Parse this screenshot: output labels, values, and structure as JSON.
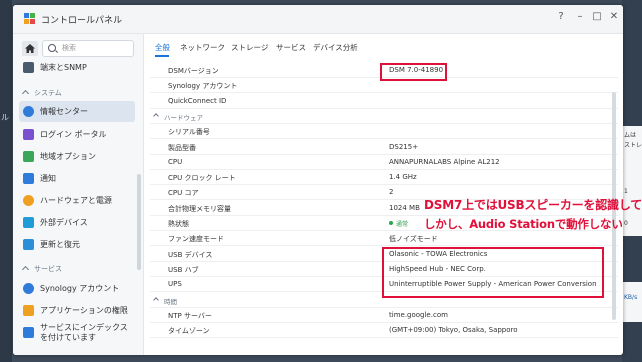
{
  "window": {
    "title": "コントロールパネル",
    "controls": [
      "?",
      "–",
      "□",
      "✕"
    ],
    "icon_colors": [
      "#2f7bd9",
      "#48b04a",
      "#f0a020",
      "#e24a4a"
    ]
  },
  "sidebar": {
    "search_placeholder": "検索",
    "items": [
      {
        "label": "端末とSNMP",
        "icon": "terminal-icon",
        "color": "#4a5a6e"
      },
      {
        "section": "システム"
      },
      {
        "label": "情報センター",
        "icon": "info-icon",
        "color": "#2f7bd9",
        "active": true
      },
      {
        "label": "ログイン ポータル",
        "icon": "portal-icon",
        "color": "#7a4fd0"
      },
      {
        "label": "地域オプション",
        "icon": "region-icon",
        "color": "#3aa657"
      },
      {
        "label": "通知",
        "icon": "notification-icon",
        "color": "#2f7bd9"
      },
      {
        "label": "ハードウェアと電源",
        "icon": "power-icon",
        "color": "#f0a020"
      },
      {
        "label": "外部デバイス",
        "icon": "external-device-icon",
        "color": "#1f9bd6"
      },
      {
        "label": "更新と復元",
        "icon": "update-icon",
        "color": "#2a8fd8"
      },
      {
        "section": "サービス"
      },
      {
        "label": "Synology アカウント",
        "icon": "account-icon",
        "color": "#2f7bd9"
      },
      {
        "label": "アプリケーションの権限",
        "icon": "lock-icon",
        "color": "#f0a020"
      },
      {
        "label": "サービスにインデックスを付けています",
        "icon": "index-icon",
        "color": "#2f7bd9"
      }
    ]
  },
  "tabs": [
    "全般",
    "ネットワーク",
    "ストレージ",
    "サービス",
    "デバイス分析"
  ],
  "info": {
    "rows": [
      {
        "key": "DSMバージョン",
        "value": "DSM 7.0-41890"
      },
      {
        "key": "Synology アカウント",
        "value": ""
      },
      {
        "key": "QuickConnect ID",
        "value": ""
      },
      {
        "section": "ハードウェア"
      },
      {
        "key": "シリアル番号",
        "value": ""
      },
      {
        "key": "製品型番",
        "value": "DS215+"
      },
      {
        "key": "CPU",
        "value": "ANNAPURNALABS Alpine AL212"
      },
      {
        "key": "CPU クロック レート",
        "value": "1.4 GHz"
      },
      {
        "key": "CPU コア",
        "value": "2"
      },
      {
        "key": "合計物理メモリ容量",
        "value": "1024 MB"
      },
      {
        "key": "熱状態",
        "value": "通常",
        "status_color": "#2ea44f"
      },
      {
        "key": "ファン速度モード",
        "value": "低ノイズモード"
      },
      {
        "key": "USB デバイス",
        "value": "Olasonic - TOWA Electronics"
      },
      {
        "key": "USB ハブ",
        "value": "HighSpeed Hub - NEC Corp."
      },
      {
        "key": "UPS",
        "value": "Uninterruptible Power Supply - American Power Conversion"
      },
      {
        "section": "時間"
      },
      {
        "key": "NTP サーバー",
        "value": "time.google.com"
      },
      {
        "key": "タイムゾーン",
        "value": "(GMT+09:00) Tokyo, Osaka, Sapporo"
      }
    ]
  },
  "annotation": {
    "line1": "DSM7上ではUSBスピーカーを認識してる。",
    "line2": "しかし、Audio Stationで動作しない",
    "color": "#e0103a"
  },
  "background": {
    "left_fragment": "ル",
    "right_fragments": [
      "ムは",
      "ストレ",
      "1",
      "0"
    ],
    "right_fragment2": "KB/s"
  }
}
